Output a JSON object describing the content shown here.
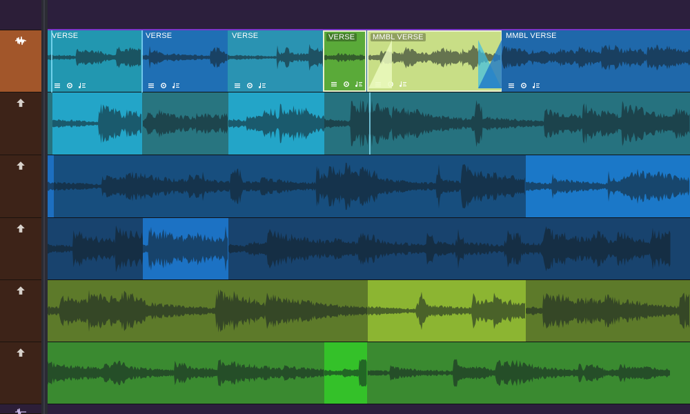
{
  "colors": {
    "track_header": "#3d2318",
    "selected_header": "#a2562a",
    "top_bar": "#2c1f3d",
    "accent": "#7a36c9"
  },
  "icons": {
    "selected_track": "waveform-icon",
    "track_arrow": "arrow-up-icon",
    "region_tools": [
      "lines-icon",
      "gear-icon",
      "music-note-icon"
    ]
  },
  "tracks": [
    {
      "name": "track-1",
      "bg": "#1f5f9c",
      "regions": [
        {
          "label": "VERSE",
          "from": 0.0,
          "to": 0.146,
          "color": "#2297b0",
          "tools": true
        },
        {
          "label": "VERSE",
          "from": 0.146,
          "to": 0.28,
          "color": "#1f6fb4",
          "tools": true
        },
        {
          "label": "VERSE",
          "from": 0.28,
          "to": 0.429,
          "color": "#2a93b2",
          "tools": true
        },
        {
          "label": "VERSE",
          "from": 0.429,
          "to": 0.497,
          "color": "#5aaa39",
          "tools": true,
          "selected": true,
          "boxed": true
        },
        {
          "label": "MMBL VERSE",
          "from": 0.497,
          "to": 0.707,
          "color": "#c8de86",
          "tools": true,
          "selected": true,
          "boxed": true
        },
        {
          "label": "MMBL VERSE",
          "from": 0.707,
          "to": 1.0,
          "color": "#1f68aa",
          "tools": true
        }
      ]
    },
    {
      "name": "track-2",
      "bg": "#26727f",
      "regions": [
        {
          "label": "",
          "from": 0.008,
          "to": 0.148,
          "color": "#23a5c8"
        },
        {
          "label": "",
          "from": 0.148,
          "to": 0.281,
          "color": "#287580"
        },
        {
          "label": "",
          "from": 0.281,
          "to": 0.431,
          "color": "#23a5c8"
        },
        {
          "label": "",
          "from": 0.431,
          "to": 1.0,
          "color": "#26727f"
        }
      ]
    },
    {
      "name": "track-3",
      "bg": "#174e7e",
      "regions": [
        {
          "label": "",
          "from": 0.0,
          "to": 0.01,
          "color": "#1d6fc0"
        },
        {
          "label": "",
          "from": 0.01,
          "to": 0.744,
          "color": "#174e7e"
        },
        {
          "label": "",
          "from": 0.744,
          "to": 1.0,
          "color": "#1b78c8"
        }
      ]
    },
    {
      "name": "track-4",
      "bg": "#18436e",
      "regions": [
        {
          "label": "",
          "from": 0.0,
          "to": 0.148,
          "color": "#18436e"
        },
        {
          "label": "",
          "from": 0.148,
          "to": 0.281,
          "color": "#1c72c4"
        },
        {
          "label": "",
          "from": 0.281,
          "to": 0.969,
          "color": "#18436e"
        }
      ]
    },
    {
      "name": "track-5",
      "bg": "#5d7a2a",
      "regions": [
        {
          "label": "",
          "from": 0.0,
          "to": 0.498,
          "color": "#5d7a2a"
        },
        {
          "label": "",
          "from": 0.498,
          "to": 0.744,
          "color": "#8cb532"
        },
        {
          "label": "",
          "from": 0.744,
          "to": 1.0,
          "color": "#5d7a2a"
        }
      ]
    },
    {
      "name": "track-6",
      "bg": "#3a8a30",
      "regions": [
        {
          "label": "",
          "from": 0.0,
          "to": 0.431,
          "color": "#3a8a30"
        },
        {
          "label": "",
          "from": 0.431,
          "to": 0.498,
          "color": "#34c129"
        },
        {
          "label": "",
          "from": 0.498,
          "to": 0.969,
          "color": "#3a8a30"
        }
      ]
    }
  ]
}
